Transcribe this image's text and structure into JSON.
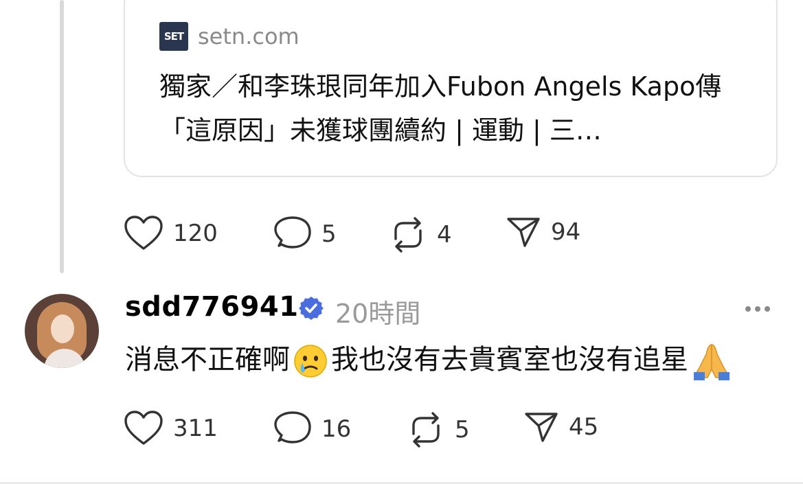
{
  "link_card": {
    "source_logo": "SET",
    "domain": "setn.com",
    "title": "獨家／和李珠珢同年加入Fubon Angels Kapo傳「這原因」未獲球團續約 | 運動 | 三…"
  },
  "post_actions": {
    "likes": "120",
    "replies": "5",
    "reposts": "4",
    "shares": "94"
  },
  "reply": {
    "username": "sdd776941",
    "verified": true,
    "timestamp": "20時間",
    "text_part1": "消息不正確啊",
    "text_part2": "我也沒有去貴賓室也沒有追星",
    "emoji_1": "crying-face",
    "emoji_2": "folded-hands",
    "actions": {
      "likes": "311",
      "replies": "16",
      "reposts": "5",
      "shares": "45"
    }
  },
  "icons": [
    "heart-icon",
    "comment-icon",
    "repost-icon",
    "share-icon",
    "verified-badge-icon",
    "more-icon"
  ],
  "colors": {
    "verified_badge": "#4a6ee0",
    "muted_text": "#9a9a9a",
    "icon_stroke": "#333333",
    "card_border": "#e3e3e3"
  }
}
